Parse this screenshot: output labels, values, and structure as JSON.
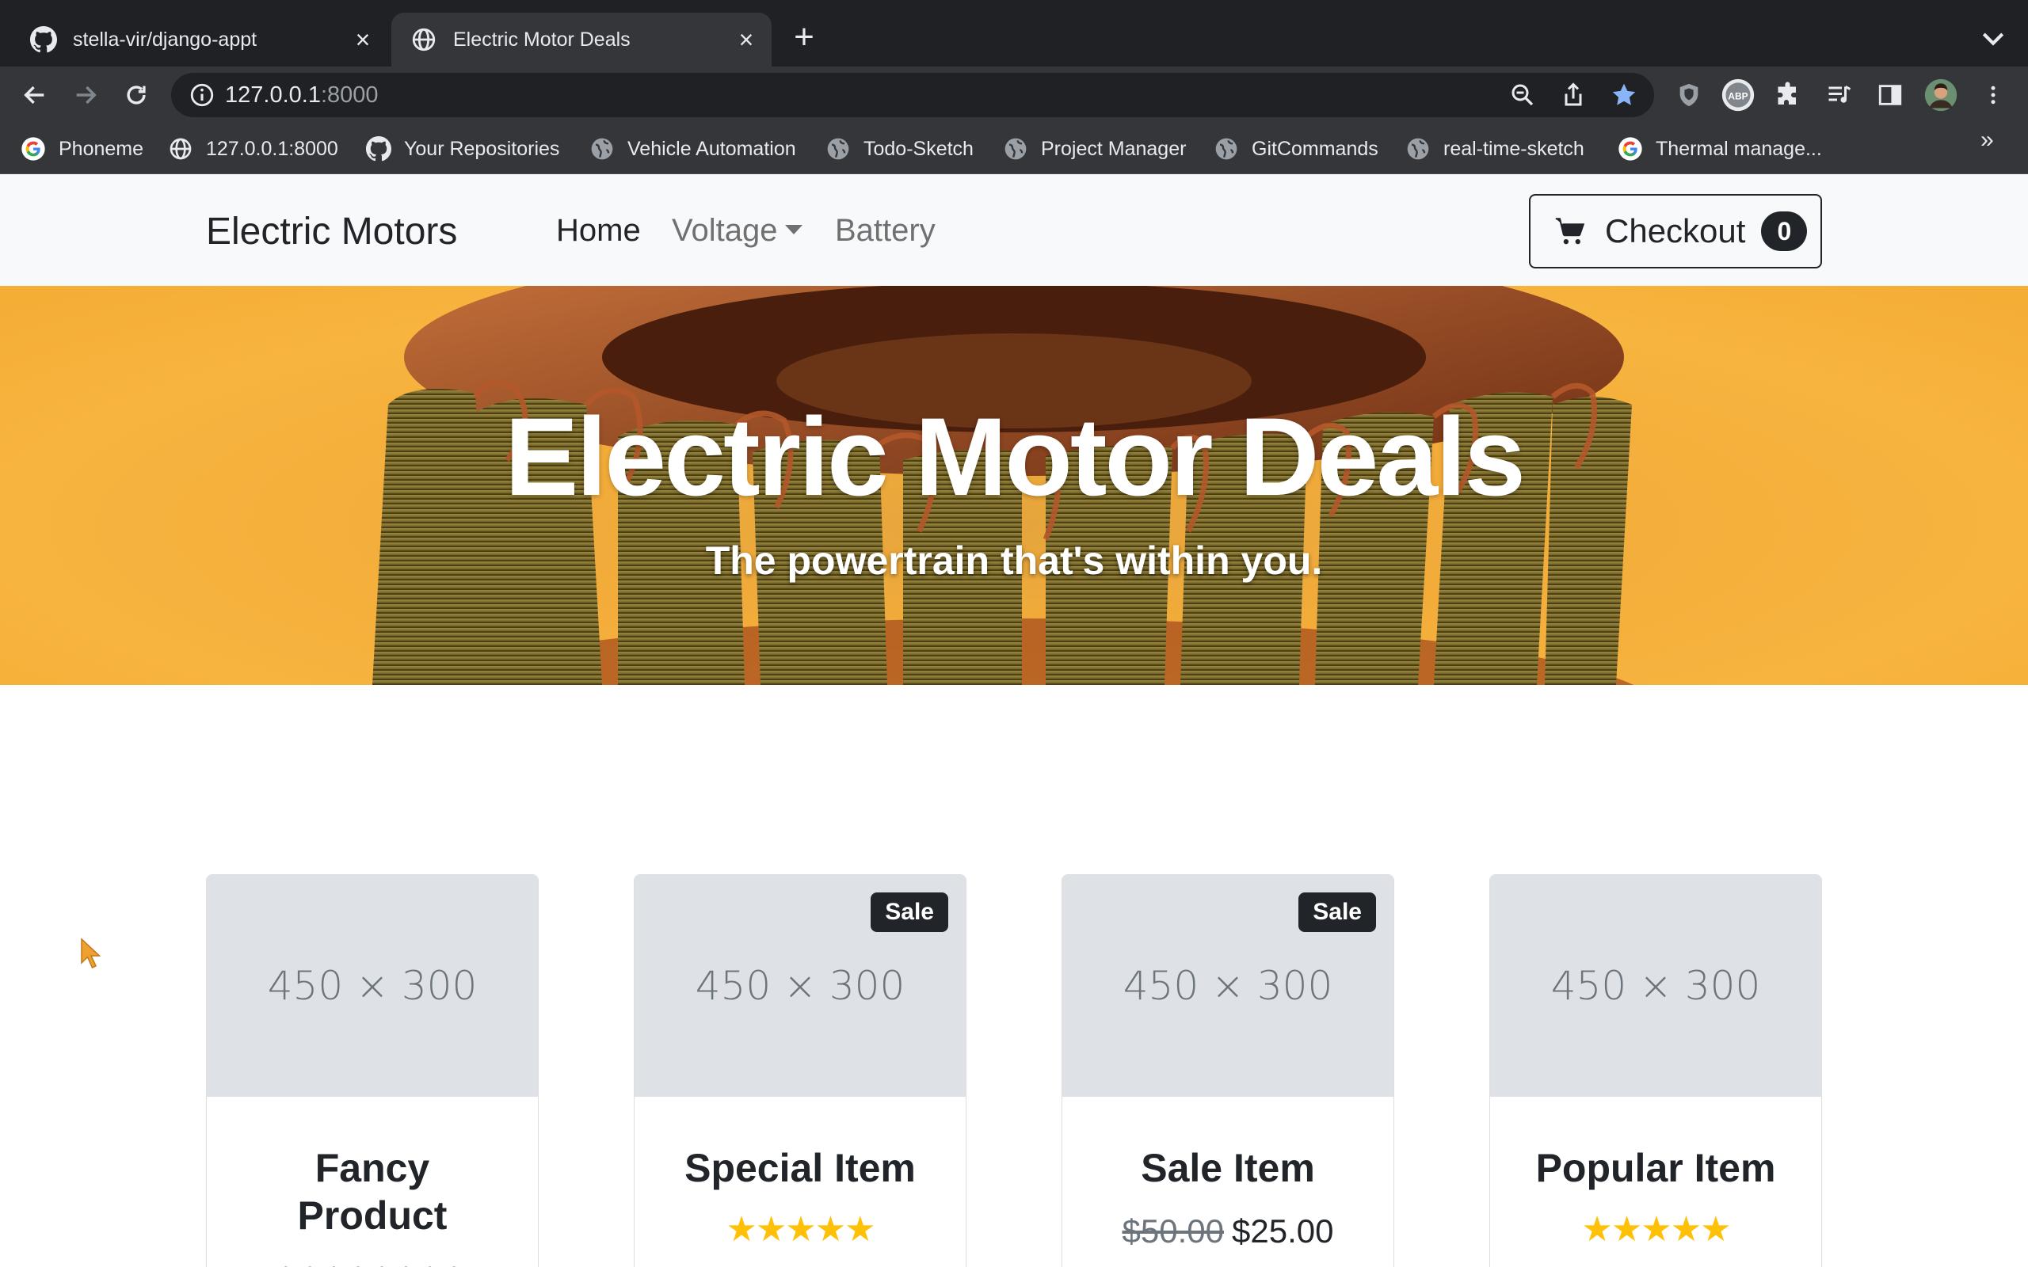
{
  "browser": {
    "tabs": [
      {
        "title": "stella-vir/django-appt",
        "icon": "github-icon"
      },
      {
        "title": "Electric Motor Deals",
        "icon": "globe-icon"
      }
    ],
    "url_host": "127.0.0.1",
    "url_port": ":8000",
    "bookmarks": [
      {
        "label": "Phoneme",
        "icon": "google-icon"
      },
      {
        "label": "127.0.0.1:8000",
        "icon": "globe-icon"
      },
      {
        "label": "Your Repositories",
        "icon": "github-icon"
      },
      {
        "label": "Vehicle Automation",
        "icon": "world-icon"
      },
      {
        "label": "Todo-Sketch",
        "icon": "world-icon"
      },
      {
        "label": "Project Manager",
        "icon": "world-icon"
      },
      {
        "label": "GitCommands",
        "icon": "world-icon"
      },
      {
        "label": "real-time-sketch",
        "icon": "world-icon"
      },
      {
        "label": "Thermal manage...",
        "icon": "google-icon"
      }
    ],
    "more_bookmarks": "»",
    "extension_abp": "ABP",
    "accent": "#8ab4f8"
  },
  "site": {
    "brand": "Electric Motors",
    "nav": {
      "home": "Home",
      "voltage": "Voltage",
      "battery": "Battery"
    },
    "checkout_label": "Checkout",
    "cart_count": "0"
  },
  "hero": {
    "title": "Electric Motor Deals",
    "subtitle": "The powertrain that's within you."
  },
  "products": [
    {
      "name": "Fancy Product",
      "placeholder": "450 × 300",
      "badge": "",
      "rating": 0
    },
    {
      "name": "Special Item",
      "placeholder": "450 × 300",
      "badge": "Sale",
      "rating": 5
    },
    {
      "name": "Sale Item",
      "placeholder": "450 × 300",
      "badge": "Sale",
      "old_price": "$50.00",
      "price": "$25.00"
    },
    {
      "name": "Popular Item",
      "placeholder": "450 × 300",
      "badge": "",
      "rating": 5
    }
  ],
  "stars_text": "★★★★★",
  "colors": {
    "star": "#ffc107",
    "badge_bg": "#212529",
    "hero_bg": "#f3ac3a",
    "thumb_bg": "#dee2e6"
  }
}
